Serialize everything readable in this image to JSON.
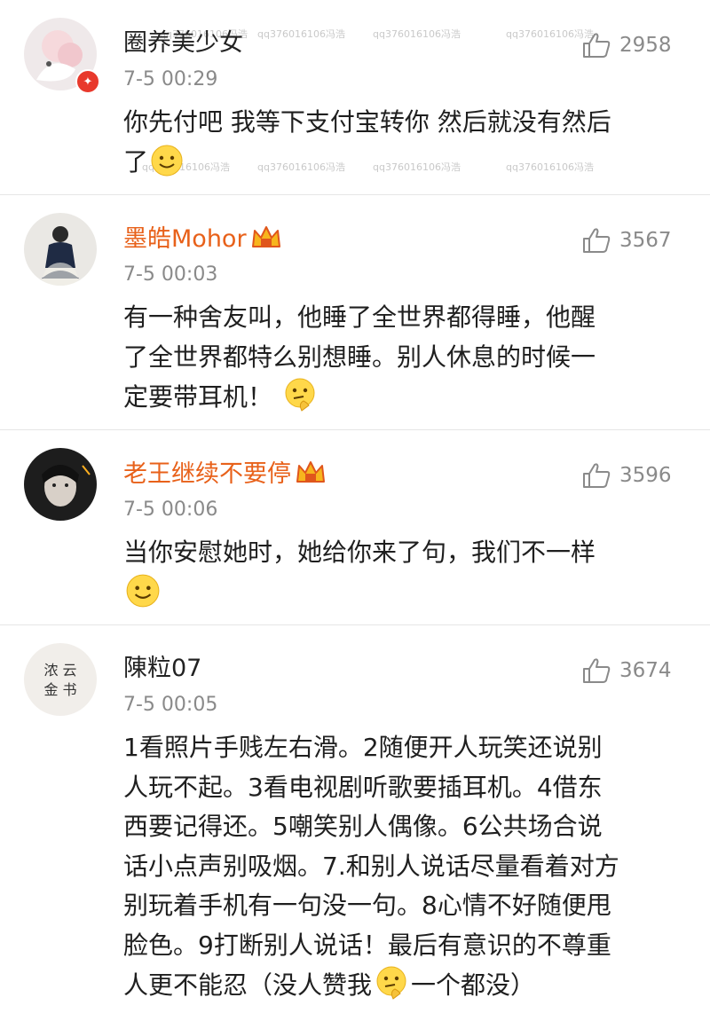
{
  "comments": [
    {
      "username": "圈养美少女",
      "time": "7-5 00:29",
      "likes": "2958",
      "text_lines": [
        "你先付吧 我等下支付宝转你 然后就没有然后",
        "了"
      ],
      "vip": false,
      "verified_badge": true,
      "trailing_emoji": "smile"
    },
    {
      "username": "墨皓Mohor",
      "time": "7-5 00:03",
      "likes": "3567",
      "text_lines": [
        "有一种舍友叫，他睡了全世界都得睡，他醒",
        "了全世界都特么别想睡。别人休息的时候一",
        "定要带耳机！"
      ],
      "vip": true,
      "trailing_emoji": "thinking"
    },
    {
      "username": "老王继续不要停",
      "time": "7-5 00:06",
      "likes": "3596",
      "text_lines": [
        "当你安慰她时，她给你来了句，我们不一样",
        ""
      ],
      "vip": true,
      "trailing_emoji": "smile"
    },
    {
      "username": "陳粒07",
      "time": "7-5 00:05",
      "likes": "3674",
      "text_lines": [
        "1看照片手贱左右滑。2随便开人玩笑还说别",
        "人玩不起。3看电视剧听歌要插耳机。4借东",
        "西要记得还。5嘲笑别人偶像。6公共场合说",
        "话小点声别吸烟。7.和别人说话尽量看着对方",
        "别玩着手机有一句没一句。8心情不好随便甩",
        "脸色。9打断别人说话！最后有意识的不尊重",
        "人更不能忍（没人赞我"
      ],
      "last_line_suffix": "一个都没）",
      "vip": false,
      "inline_emoji": "thinking"
    }
  ],
  "watermark": "qq376016106冯浩",
  "colors": {
    "vip_name": "#e8611a",
    "meta_gray": "#8a8a8a",
    "badge_red": "#e8392c"
  },
  "icons": {
    "like": "thumbs-up-icon",
    "crown": "vip-crown-icon",
    "emoji_smile": "smile-emoji-icon",
    "emoji_thinking": "thinking-emoji-icon"
  }
}
